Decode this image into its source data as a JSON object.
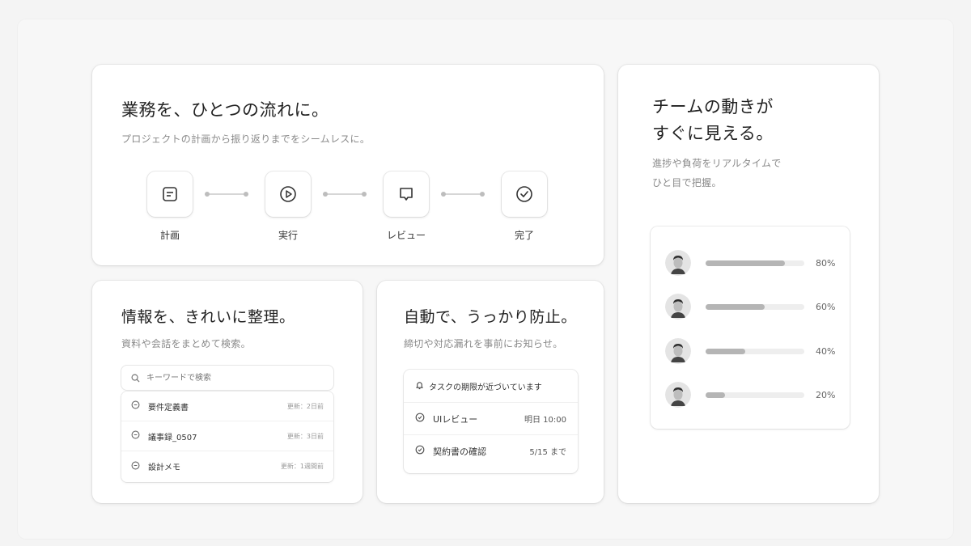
{
  "flow": {
    "title": "業務を、ひとつの流れに。",
    "subtitle": "プロジェクトの計画から振り返りまでをシームレスに。",
    "steps": [
      {
        "label": "計画",
        "icon": "document-icon"
      },
      {
        "label": "実行",
        "icon": "play-icon"
      },
      {
        "label": "レビュー",
        "icon": "chat-bubble-icon"
      },
      {
        "label": "完了",
        "icon": "check-circle-icon"
      }
    ]
  },
  "info": {
    "title": "情報を、きれいに整理。",
    "subtitle": "資料や会話をまとめて検索。",
    "search_placeholder": "キーワードで検索",
    "documents": [
      {
        "name": "要件定義書",
        "updated": "更新：2日前"
      },
      {
        "name": "議事録_0507",
        "updated": "更新：3日前"
      },
      {
        "name": "設計メモ",
        "updated": "更新：1週間前"
      }
    ]
  },
  "auto": {
    "title": "自動で、うっかり防止。",
    "subtitle": "締切や対応漏れを事前にお知らせ。",
    "notice_title": "タスクの期限が近づいています",
    "tasks": [
      {
        "name": "UIレビュー",
        "due": "明日 10:00"
      },
      {
        "name": "契約書の確認",
        "due": "5/15 まで"
      }
    ]
  },
  "team": {
    "title_line1": "チームの動きが",
    "title_line2": "すぐに見える。",
    "subtitle_line1": "進捗や負荷をリアルタイムで",
    "subtitle_line2": "ひと目で把握。",
    "members": [
      {
        "progress": 80,
        "label": "80%"
      },
      {
        "progress": 60,
        "label": "60%"
      },
      {
        "progress": 40,
        "label": "40%"
      },
      {
        "progress": 20,
        "label": "20%"
      }
    ]
  }
}
